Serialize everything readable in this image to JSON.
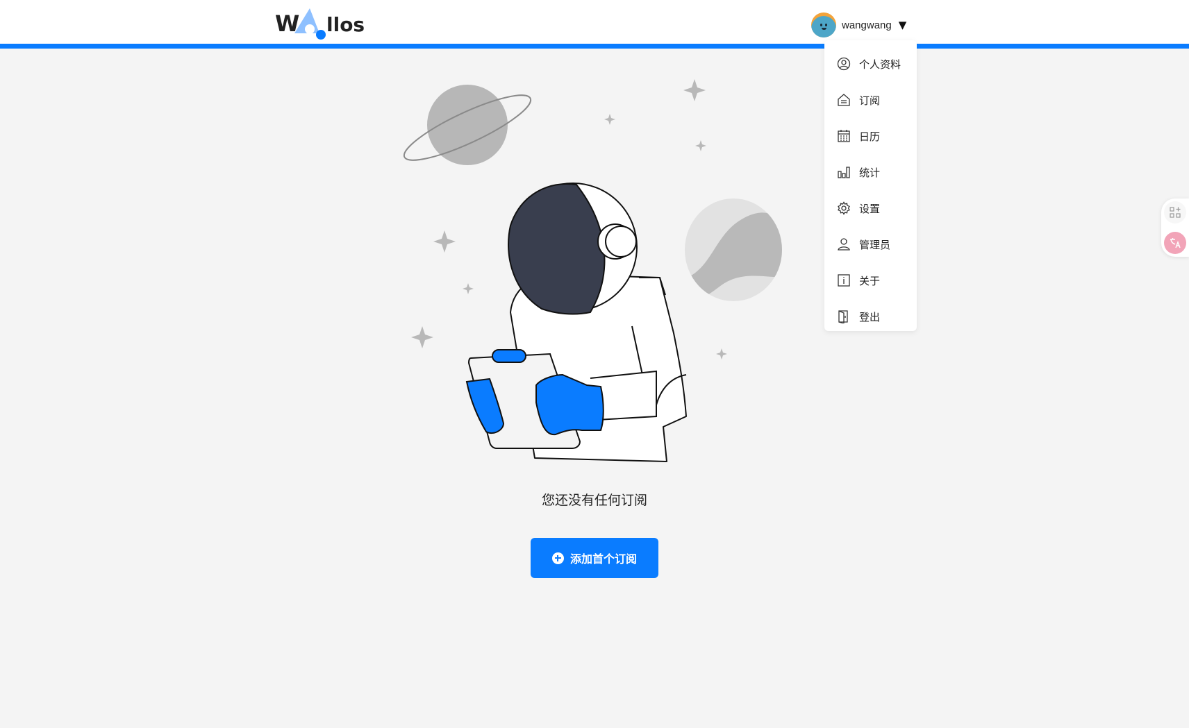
{
  "app": {
    "logo_text_left": "W",
    "logo_text_right": "llos"
  },
  "header": {
    "username": "wangwang",
    "caret": "▼"
  },
  "dropdown": {
    "items": [
      {
        "label": "个人资料",
        "icon": "user-circle-icon"
      },
      {
        "label": "订阅",
        "icon": "home-icon"
      },
      {
        "label": "日历",
        "icon": "calendar-icon"
      },
      {
        "label": "统计",
        "icon": "bar-chart-icon"
      },
      {
        "label": "设置",
        "icon": "gear-icon"
      },
      {
        "label": "管理员",
        "icon": "admin-user-icon"
      },
      {
        "label": "关于",
        "icon": "info-icon"
      },
      {
        "label": "登出",
        "icon": "logout-icon"
      }
    ]
  },
  "main": {
    "empty_message": "您还没有任何订阅",
    "add_button_label": "添加首个订阅"
  },
  "colors": {
    "accent": "#0a7cff",
    "background": "#f4f4f4",
    "helmet_visor": "#393e4e"
  }
}
